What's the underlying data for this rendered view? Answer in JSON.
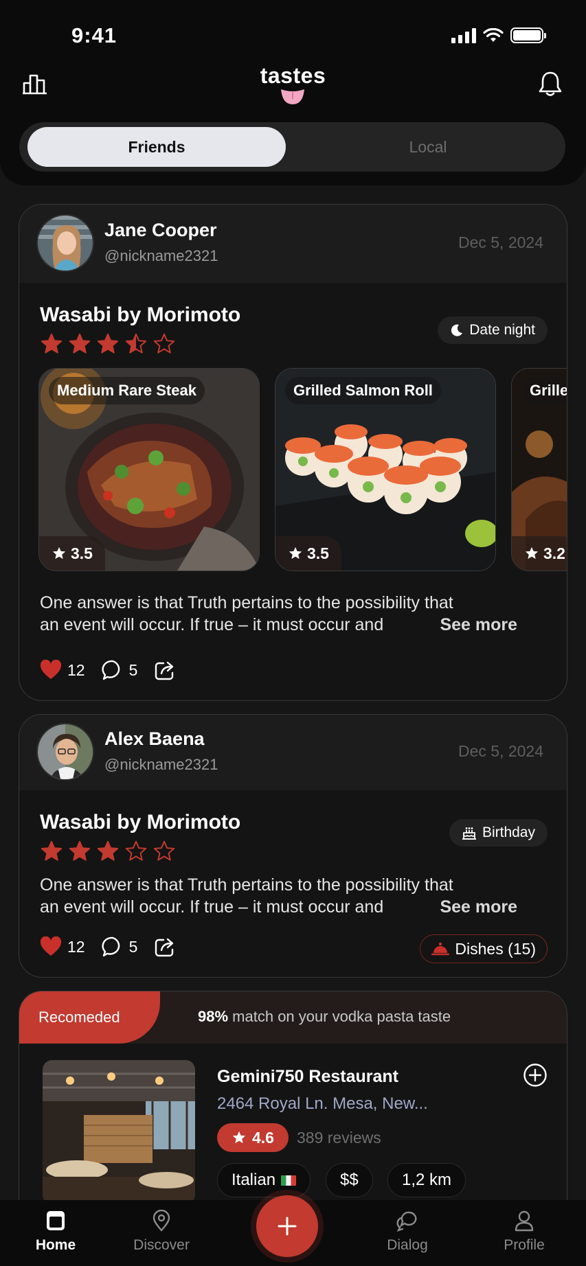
{
  "status_bar": {
    "time": "9:41"
  },
  "header": {
    "logo": "tastes"
  },
  "segmented": {
    "friends": "Friends",
    "local": "Local"
  },
  "posts": [
    {
      "user": "Jane Cooper",
      "handle": "@nickname2321",
      "date": "Dec 5, 2024",
      "restaurant": "Wasabi by Morimoto",
      "rating": 3.5,
      "tag": "Date night",
      "tag_icon": "moon-icon",
      "dishes": [
        {
          "name": "Medium Rare Steak",
          "rating": "3.5"
        },
        {
          "name": "Grilled Salmon Roll",
          "rating": "3.5"
        },
        {
          "name": "Grilled Steak",
          "rating": "3.2"
        }
      ],
      "text_line1": "One answer is that Truth pertains to the possibility that",
      "text_line2": "an event will occur. If true – it must occur and",
      "see_more": "See more",
      "likes": "12",
      "comments": "5"
    },
    {
      "user": "Alex Baena",
      "handle": "@nickname2321",
      "date": "Dec 5, 2024",
      "restaurant": "Wasabi by Morimoto",
      "rating": 3,
      "tag": "Birthday",
      "tag_icon": "cake-icon",
      "text_line1": "One answer is that Truth pertains to the possibility that",
      "text_line2": "an event will occur. If true – it must occur and",
      "see_more": "See more",
      "likes": "12",
      "comments": "5",
      "dishes_button": "Dishes (15)"
    }
  ],
  "recommended": {
    "badge": "Recomeded",
    "match_percent": "98%",
    "match_text": "match on your vodka pasta taste",
    "name": "Gemini750 Restaurant",
    "address": "2464 Royal Ln. Mesa, New...",
    "rating": "4.6",
    "reviews": "389 reviews",
    "cuisine": "Italian",
    "price": "$$",
    "distance": "1,2 km"
  },
  "tabbar": {
    "home": "Home",
    "discover": "Discover",
    "dialog": "Dialog",
    "profile": "Profile"
  },
  "colors": {
    "accent": "#c23a30",
    "background": "#161616",
    "card": "#141414"
  }
}
